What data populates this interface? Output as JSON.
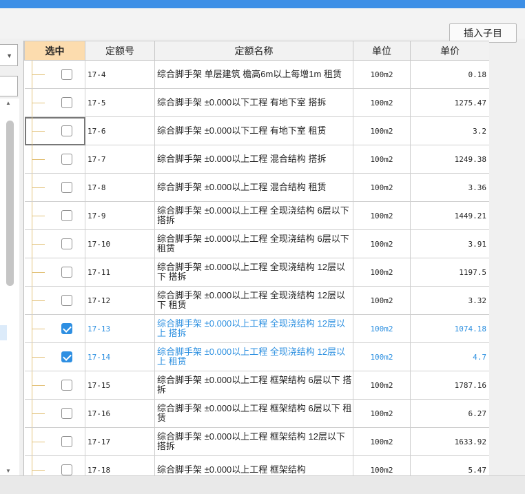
{
  "toolbar": {
    "insert_label": "插入子目"
  },
  "table": {
    "headers": {
      "select": "选中",
      "code": "定额号",
      "name": "定额名称",
      "unit": "单位",
      "price": "单价"
    },
    "rows": [
      {
        "code": "17-4",
        "name": "综合脚手架 单层建筑 檐高6m以上每增1m 租赁",
        "unit": "100m2",
        "price": "0.18",
        "checked": false
      },
      {
        "code": "17-5",
        "name": "综合脚手架 ±0.000以下工程 有地下室 搭拆",
        "unit": "100m2",
        "price": "1275.47",
        "checked": false
      },
      {
        "code": "17-6",
        "name": "综合脚手架 ±0.000以下工程 有地下室 租赁",
        "unit": "100m2",
        "price": "3.2",
        "checked": false
      },
      {
        "code": "17-7",
        "name": "综合脚手架 ±0.000以上工程 混合结构 搭拆",
        "unit": "100m2",
        "price": "1249.38",
        "checked": false
      },
      {
        "code": "17-8",
        "name": "综合脚手架 ±0.000以上工程 混合结构 租赁",
        "unit": "100m2",
        "price": "3.36",
        "checked": false
      },
      {
        "code": "17-9",
        "name": "综合脚手架 ±0.000以上工程 全现浇结构 6层以下 搭拆",
        "unit": "100m2",
        "price": "1449.21",
        "checked": false
      },
      {
        "code": "17-10",
        "name": "综合脚手架 ±0.000以上工程 全现浇结构 6层以下 租赁",
        "unit": "100m2",
        "price": "3.91",
        "checked": false
      },
      {
        "code": "17-11",
        "name": "综合脚手架 ±0.000以上工程 全现浇结构 12层以下 搭拆",
        "unit": "100m2",
        "price": "1197.5",
        "checked": false
      },
      {
        "code": "17-12",
        "name": "综合脚手架 ±0.000以上工程 全现浇结构 12层以下 租赁",
        "unit": "100m2",
        "price": "3.32",
        "checked": false
      },
      {
        "code": "17-13",
        "name": "综合脚手架 ±0.000以上工程 全现浇结构 12层以上 搭拆",
        "unit": "100m2",
        "price": "1074.18",
        "checked": true
      },
      {
        "code": "17-14",
        "name": "综合脚手架 ±0.000以上工程 全现浇结构 12层以上 租赁",
        "unit": "100m2",
        "price": "4.7",
        "checked": true
      },
      {
        "code": "17-15",
        "name": "综合脚手架 ±0.000以上工程 框架结构 6层以下 搭拆",
        "unit": "100m2",
        "price": "1787.16",
        "checked": false
      },
      {
        "code": "17-16",
        "name": "综合脚手架 ±0.000以上工程 框架结构 6层以下 租赁",
        "unit": "100m2",
        "price": "6.27",
        "checked": false
      },
      {
        "code": "17-17",
        "name": "综合脚手架 ±0.000以上工程 框架结构 12层以下 搭拆",
        "unit": "100m2",
        "price": "1633.92",
        "checked": false
      },
      {
        "code": "17-18",
        "name": "综合脚手架 ±0.000以上工程 框架结构",
        "unit": "100m2",
        "price": "5.47",
        "checked": false
      }
    ]
  },
  "colors": {
    "accent": "#3d8fe6",
    "checked_text": "#2b8fe0",
    "select_header": "#fcdcae"
  }
}
